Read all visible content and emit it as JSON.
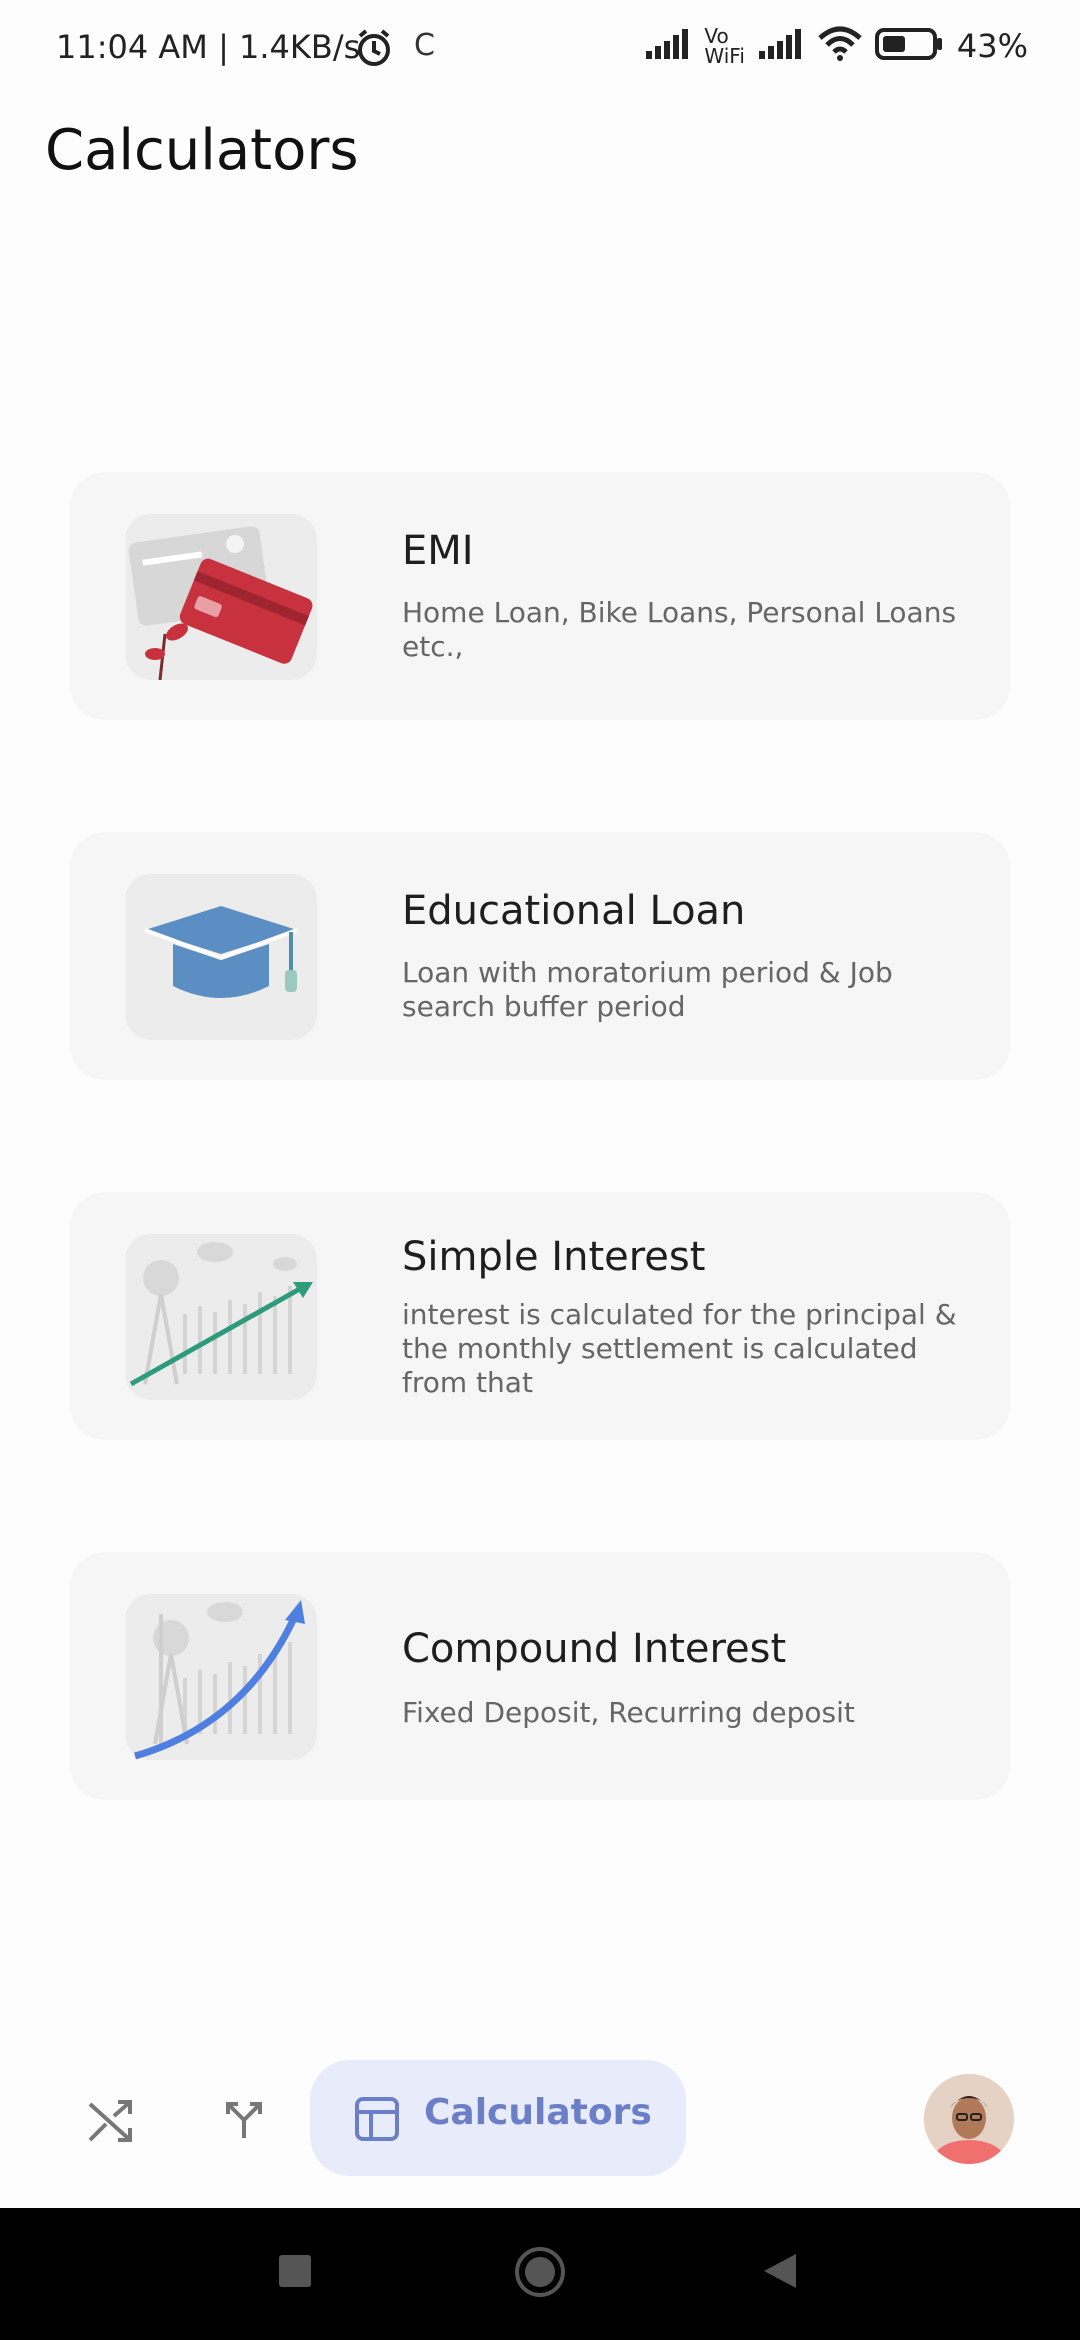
{
  "status_bar": {
    "time": "11:04 AM | 1.4KB/s",
    "extra": "C",
    "network_label_top": "Vo",
    "network_label_bottom": "WiFi",
    "battery": "43%"
  },
  "page": {
    "title": "Calculators"
  },
  "cards": [
    {
      "title": "EMI",
      "description": "Home Loan, Bike Loans, Personal Loans etc.,",
      "icon": "credit-cards-icon"
    },
    {
      "title": "Educational Loan",
      "description": "Loan with moratorium period & Job search buffer period",
      "icon": "graduation-cap-icon"
    },
    {
      "title": "Simple Interest",
      "description": "interest is calculated for the principal & the monthly settlement is calculated from that",
      "icon": "linear-growth-chart-icon"
    },
    {
      "title": "Compound Interest",
      "description": "Fixed Deposit, Recurring deposit",
      "icon": "exponential-growth-chart-icon"
    }
  ],
  "bottom_nav": {
    "items": [
      {
        "icon": "shuffle-icon"
      },
      {
        "icon": "split-arrow-icon"
      },
      {
        "icon": "calculator-layout-icon",
        "label": "Calculators",
        "active": true
      },
      {
        "icon": "profile-avatar"
      }
    ]
  },
  "colors": {
    "accent": "#6b7fc9",
    "accent_bg": "#e8ecfa",
    "card_bg": "#f6f6f6",
    "cap_blue": "#5b8fc4",
    "card_red": "#c8323e",
    "arrow_green": "#2e9b7d",
    "arrow_blue": "#4f7fe0"
  }
}
